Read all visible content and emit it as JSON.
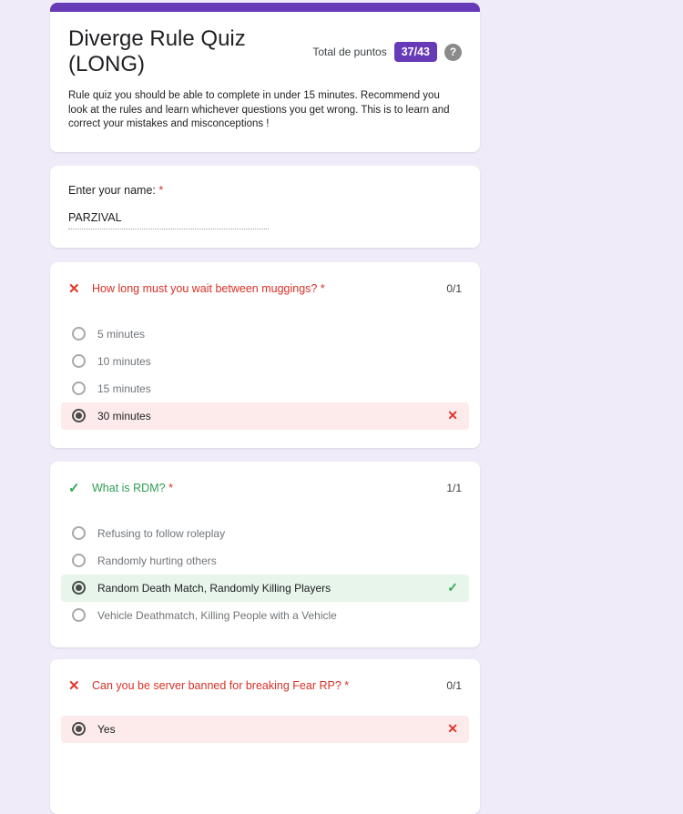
{
  "colors": {
    "accent": "#673ab7",
    "background": "#f0ebf8",
    "incorrect_red": "#d93025",
    "incorrect_row_bg": "#fcebea",
    "correct_green": "#34a853",
    "correct_row_bg": "#e7f5eb"
  },
  "icons": {
    "incorrect": "✕",
    "correct": "✓",
    "help": "?"
  },
  "header": {
    "title": "Diverge Rule Quiz (LONG)",
    "points_label": "Total de puntos",
    "points_value": "37/43",
    "description": "Rule quiz you should be able to complete in under 15 minutes. Recommend you look at the rules and learn whichever questions you get wrong. This is to learn and correct your mistakes and misconceptions !"
  },
  "name_card": {
    "label": "Enter your name:",
    "required_mark": "*",
    "value": "PARZIVAL"
  },
  "questions": [
    {
      "status": "incorrect",
      "text": "How long must you wait between muggings?",
      "required_mark": "*",
      "score": "0/1",
      "options": [
        {
          "label": "5 minutes",
          "selected": false
        },
        {
          "label": "10 minutes",
          "selected": false
        },
        {
          "label": "15 minutes",
          "selected": false
        },
        {
          "label": "30 minutes",
          "selected": true,
          "result": "incorrect"
        }
      ]
    },
    {
      "status": "correct",
      "text": "What is RDM?",
      "required_mark": "*",
      "score": "1/1",
      "options": [
        {
          "label": "Refusing to follow roleplay",
          "selected": false
        },
        {
          "label": "Randomly hurting others",
          "selected": false
        },
        {
          "label": "Random Death Match, Randomly Killing Players",
          "selected": true,
          "result": "correct"
        },
        {
          "label": "Vehicle Deathmatch, Killing People with a Vehicle",
          "selected": false
        }
      ]
    },
    {
      "status": "incorrect",
      "text": "Can you be server banned for breaking Fear RP?",
      "required_mark": "*",
      "score": "0/1",
      "options": [
        {
          "label": "Yes",
          "selected": true,
          "result": "incorrect"
        }
      ]
    }
  ]
}
